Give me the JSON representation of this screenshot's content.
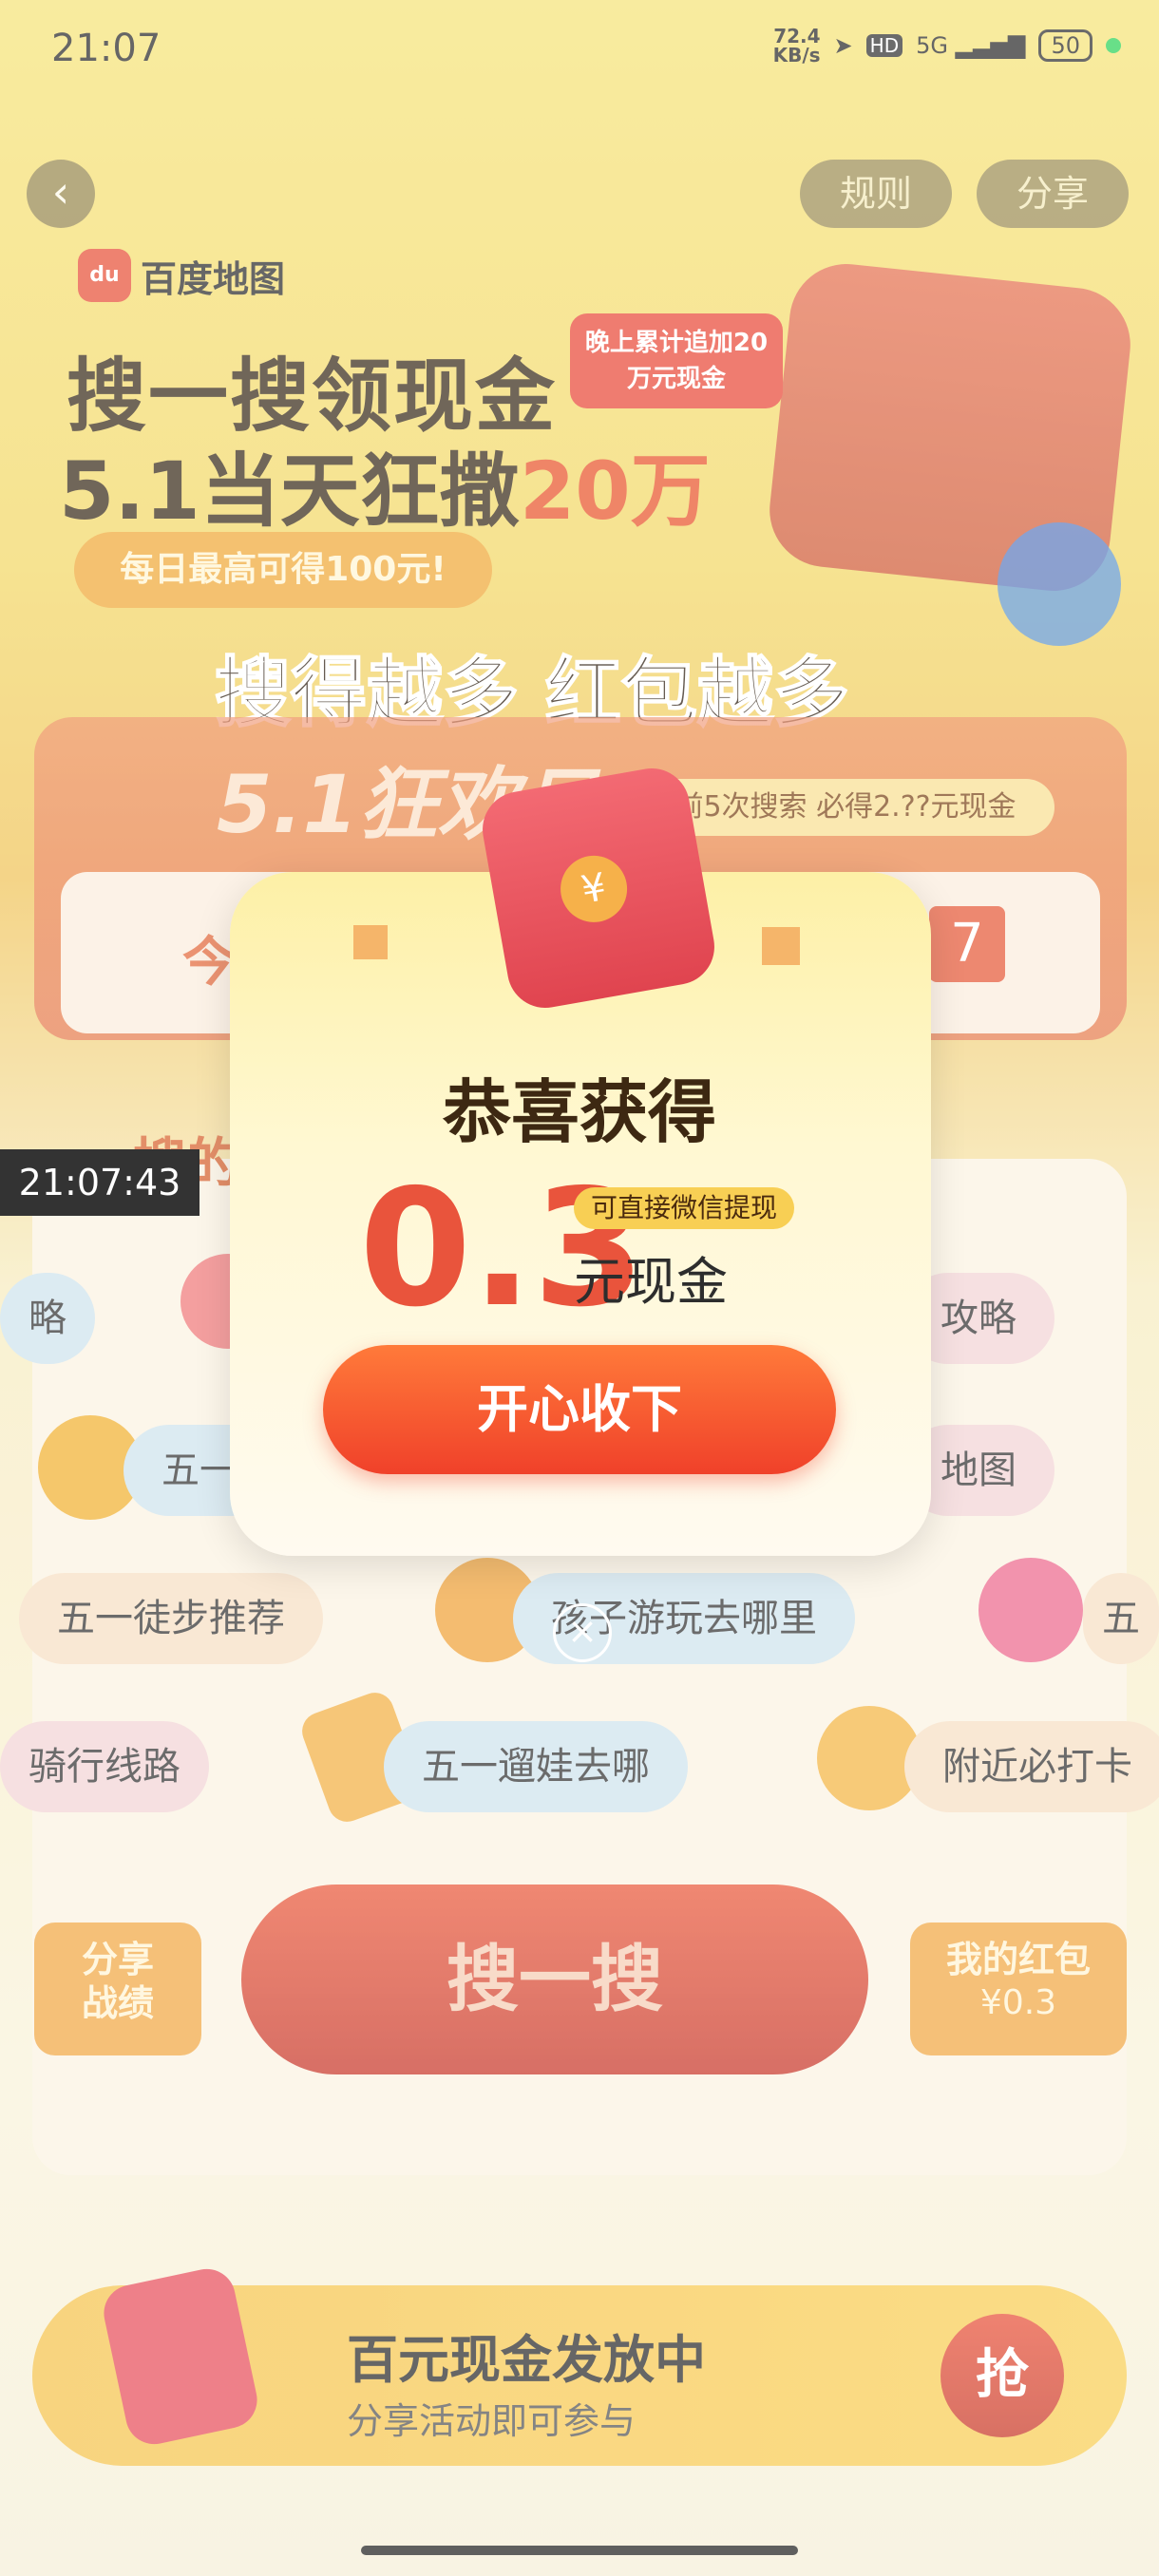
{
  "status_bar": {
    "time": "21:07",
    "speed_value": "72.4",
    "speed_unit": "KB/s",
    "hd": "HD",
    "network": "5G",
    "battery": "50"
  },
  "nav": {
    "back_icon": "‹",
    "rules_label": "规则",
    "share_label": "分享"
  },
  "brand": {
    "logo_text": "du",
    "name": "百度地图"
  },
  "hero": {
    "headline_1": "搜一搜领现金",
    "headline_2_prefix": "5.1当天狂撒",
    "headline_2_amount": "20万",
    "evening_tag": "晚上累计追加20万元现金",
    "daily_max": "每日最高可得100元!",
    "slogan": "搜得越多 红包越多"
  },
  "festival_card": {
    "title": "5.1狂欢日",
    "tip": "前5次搜索 必得2.??元现金",
    "left_text": "今",
    "right_text": "7"
  },
  "recording_timestamp": "21:07:43",
  "keywords": [
    "略",
    "攻略",
    "五一",
    "地图",
    "五一徒步推荐",
    "孩子游玩去哪里",
    "五",
    "骑行线路",
    "五一遛娃去哪",
    "附近必打卡"
  ],
  "panel_partial_label": "搜的",
  "actions": {
    "share_results": "分享\n战绩",
    "search": "搜一搜",
    "my_redpacket": "我的红包",
    "my_redpacket_amount": "¥0.3"
  },
  "banner": {
    "title": "百元现金发放中",
    "subtitle": "分享活动即可参与",
    "grab": "抢"
  },
  "modal": {
    "title": "恭喜获得",
    "amount": "0.3",
    "tag": "可直接微信提现",
    "unit": "元现金",
    "accept": "开心收下",
    "close_icon": "×",
    "coin_symbol": "¥"
  },
  "colors": {
    "accent_red": "#e9543c",
    "accept_button": "#f0412a",
    "tag_yellow": "#f8cf54"
  }
}
